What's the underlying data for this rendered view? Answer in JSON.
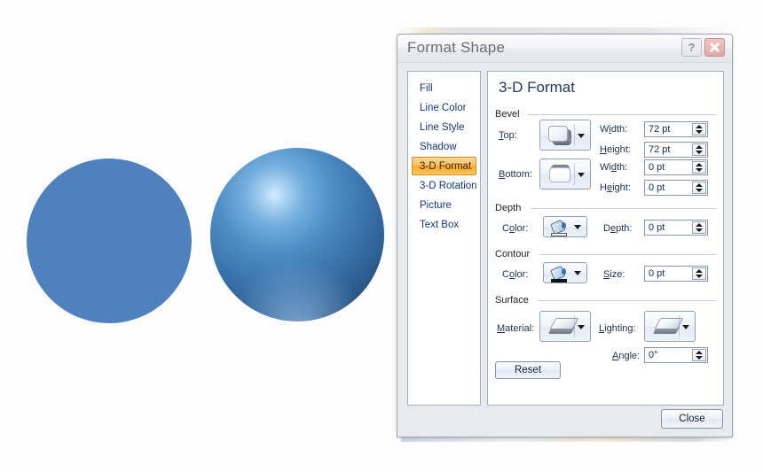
{
  "shapes": {
    "flat_circle_color": "#4e81bd",
    "sphere_base_color": "#3a73ab",
    "sphere_highlight_color": "#d8ecff"
  },
  "dialog": {
    "title": "Format Shape",
    "help_label": "?",
    "close_icon_label": "Close",
    "sidebar": [
      {
        "label": "Fill",
        "selected": false
      },
      {
        "label": "Line Color",
        "selected": false
      },
      {
        "label": "Line Style",
        "selected": false
      },
      {
        "label": "Shadow",
        "selected": false
      },
      {
        "label": "3-D Format",
        "selected": true
      },
      {
        "label": "3-D Rotation",
        "selected": false
      },
      {
        "label": "Picture",
        "selected": false
      },
      {
        "label": "Text Box",
        "selected": false
      }
    ],
    "panel": {
      "heading": "3-D Format",
      "groups": {
        "bevel": {
          "label": "Bevel",
          "top_label": "Top:",
          "bottom_label": "Bottom:",
          "top_width_label": "Width:",
          "top_width_value": "72 pt",
          "top_height_label": "Height:",
          "top_height_value": "72 pt",
          "bottom_width_label": "Width:",
          "bottom_width_value": "0 pt",
          "bottom_height_label": "Height:",
          "bottom_height_value": "0 pt"
        },
        "depth": {
          "label": "Depth",
          "color_label": "Color:",
          "depth_label": "Depth:",
          "depth_value": "0 pt"
        },
        "contour": {
          "label": "Contour",
          "color_label": "Color:",
          "size_label": "Size:",
          "size_value": "0 pt"
        },
        "surface": {
          "label": "Surface",
          "material_label": "Material:",
          "lighting_label": "Lighting:",
          "angle_label": "Angle:",
          "angle_value": "0°"
        }
      },
      "reset_label": "Reset"
    },
    "close_button_label": "Close",
    "accent_selected_color": "#f7a81f",
    "panel_heading_color": "#1f3864"
  }
}
